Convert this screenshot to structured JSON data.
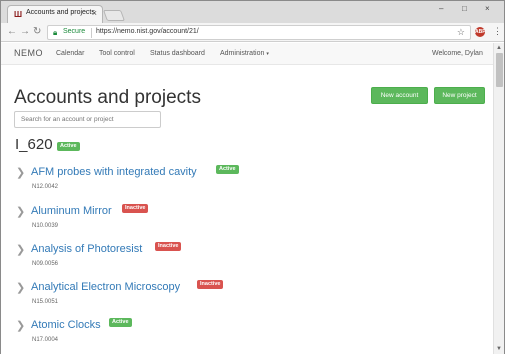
{
  "browser": {
    "tab_title": "Accounts and projects",
    "tab_close": "×",
    "favicon": "NIST",
    "secure_label": "Secure",
    "url": "https://nemo.nist.gov/account/21/",
    "extension_label": "ABP",
    "window_controls": [
      "–",
      "□",
      "×"
    ]
  },
  "nav": {
    "brand": "NEMO",
    "links": [
      "Calendar",
      "Tool control",
      "Status dashboard",
      "Administration"
    ],
    "admin_caret": "▾",
    "welcome": "Welcome, Dylan"
  },
  "page": {
    "heading": "Accounts and projects",
    "new_account_label": "New account",
    "new_project_label": "New project",
    "search_placeholder": "Search for an account or project"
  },
  "account": {
    "name": "I_620",
    "status": "Active"
  },
  "projects": [
    {
      "name": "AFM probes with integrated cavity",
      "status": "Active",
      "number": "N12.0042"
    },
    {
      "name": "Aluminum Mirror",
      "status": "Inactive",
      "number": "N10.0039"
    },
    {
      "name": "Analysis of Photoresist",
      "status": "Inactive",
      "number": "N09.0056"
    },
    {
      "name": "Analytical Electron Microscopy",
      "status": "Inactive",
      "number": "N15.0051"
    },
    {
      "name": "Atomic Clocks",
      "status": "Active",
      "number": "N17.0004"
    }
  ],
  "colors": {
    "active": "#5cb85c",
    "inactive": "#d9534f",
    "link": "#337ab7"
  }
}
